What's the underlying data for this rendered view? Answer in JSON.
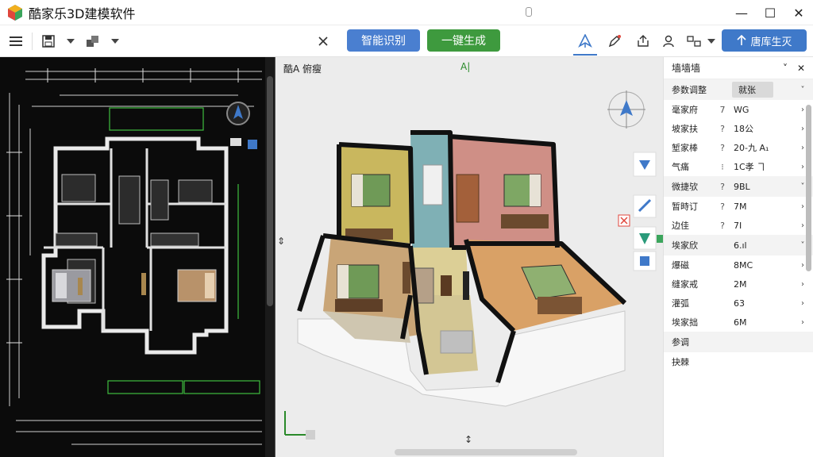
{
  "window": {
    "title": "酷家乐3D建模软件",
    "minimize": "—",
    "maximize": "☐",
    "close": "✕"
  },
  "toolbar": {
    "smart_recognize": "智能识别",
    "one_click_generate": "一键生成",
    "generate_label": "唐库生灭"
  },
  "view": {
    "label": "酷A 俯瘦",
    "top_marker": "A|"
  },
  "props": {
    "title": "墙墙墙",
    "rows": [
      {
        "label": "参数调整",
        "sym": "",
        "value": "就张",
        "chev": "˅",
        "type": "header"
      },
      {
        "label": "毫家府",
        "sym": "7",
        "value": "WG",
        "chev": "›"
      },
      {
        "label": "坡家扶",
        "sym": "?",
        "value": "18公",
        "chev": "›"
      },
      {
        "label": "堑家棒",
        "sym": "?",
        "value": "20-九 A₁",
        "chev": "›"
      },
      {
        "label": "气痛",
        "sym": "⁝",
        "value": "1C孝 ヿ",
        "chev": "›"
      },
      {
        "label": "微捷欤",
        "sym": "?",
        "value": "9BL",
        "chev": "˅",
        "type": "section"
      },
      {
        "label": "暂時订",
        "sym": "?",
        "value": "7M",
        "chev": "›"
      },
      {
        "label": "边佳",
        "sym": "?",
        "value": "7I",
        "chev": "›"
      },
      {
        "label": "埃家欣",
        "sym": "",
        "value": "6.ıl",
        "chev": "˅",
        "type": "section"
      },
      {
        "label": "爆磁",
        "sym": "",
        "value": "8MC",
        "chev": "›"
      },
      {
        "label": "缝家戒",
        "sym": "",
        "value": "2M",
        "chev": "›"
      },
      {
        "label": "灌弧",
        "sym": "",
        "value": "63",
        "chev": "›"
      },
      {
        "label": "埃家拙",
        "sym": "",
        "value": "6M",
        "chev": "›"
      },
      {
        "label": "参调",
        "sym": "",
        "value": "",
        "chev": "",
        "type": "section"
      },
      {
        "label": "抉棘",
        "sym": "",
        "value": "",
        "chev": ""
      }
    ]
  },
  "colors": {
    "blue_button": "#4a7fd0",
    "green_button": "#3e9a3e",
    "cad_background": "#0b0b0b",
    "wall": "#111111",
    "floor_wood": "#d8a868"
  }
}
